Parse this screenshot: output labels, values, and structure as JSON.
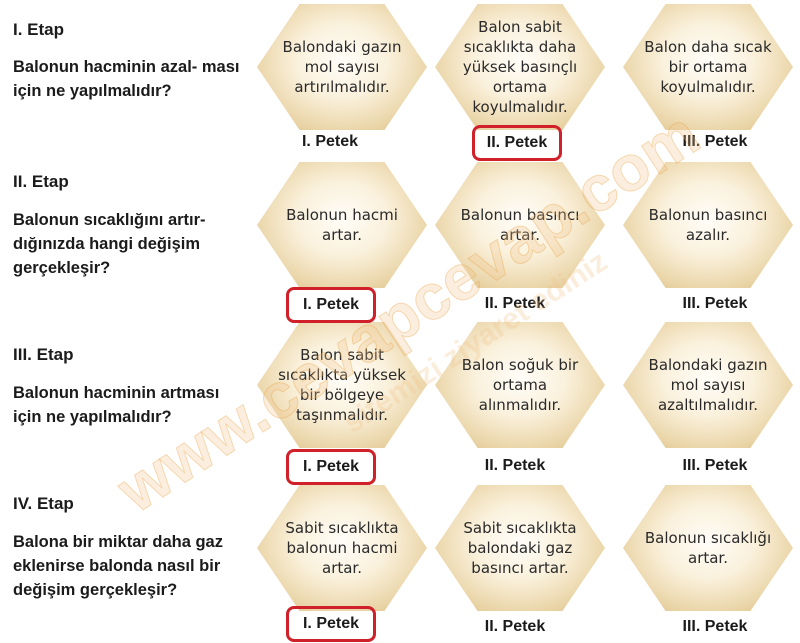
{
  "etaps": [
    {
      "title": "I. Etap",
      "question": "Balonun hacminin azal- ması için ne yapılmalıdır?",
      "options": [
        "Balondaki gazın mol sayısı artırılmalıdır.",
        "Balon sabit sıcaklıkta daha yüksek basınçlı ortama koyulmalıdır.",
        "Balon daha sıcak bir ortama koyulmalıdır."
      ],
      "labels": [
        "I. Petek",
        "II. Petek",
        "III. Petek"
      ],
      "selected_index": 1
    },
    {
      "title": "II. Etap",
      "question": "Balonun sıcaklığını artır- dığınızda hangi değişim gerçekleşir?",
      "options": [
        "Balonun hacmi artar.",
        "Balonun basıncı artar.",
        "Balonun basıncı azalır."
      ],
      "labels": [
        "I. Petek",
        "II. Petek",
        "III. Petek"
      ],
      "selected_index": 0
    },
    {
      "title": "III. Etap",
      "question": "Balonun hacminin artması için ne yapılmalıdır?",
      "options": [
        "Balon sabit sıcaklıkta yüksek bir bölgeye taşınmalıdır.",
        "Balon soğuk bir ortama alınmalıdır.",
        "Balondaki gazın mol sayısı azaltılmalıdır."
      ],
      "labels": [
        "I. Petek",
        "II. Petek",
        "III. Petek"
      ],
      "selected_index": 0
    },
    {
      "title": "IV. Etap",
      "question": "Balona bir miktar daha gaz eklenirse balonda nasıl bir değişim gerçekleşir?",
      "options": [
        "Sabit sıcaklıkta balonun hacmi artar.",
        "Sabit sıcaklıkta balondaki gaz basıncı artar.",
        "Balonun sıcaklığı artar."
      ],
      "labels": [
        "I. Petek",
        "II. Petek",
        "III. Petek"
      ],
      "selected_index": 0
    }
  ],
  "watermark": {
    "main": "www.cevapcevap.com",
    "sub": "sitemizi ziyaret ediniz",
    "color": "#e8a040"
  },
  "colors": {
    "selected_border": "#d0202a",
    "hex_center": "#fdf6e6",
    "hex_edge": "#d8b878"
  }
}
